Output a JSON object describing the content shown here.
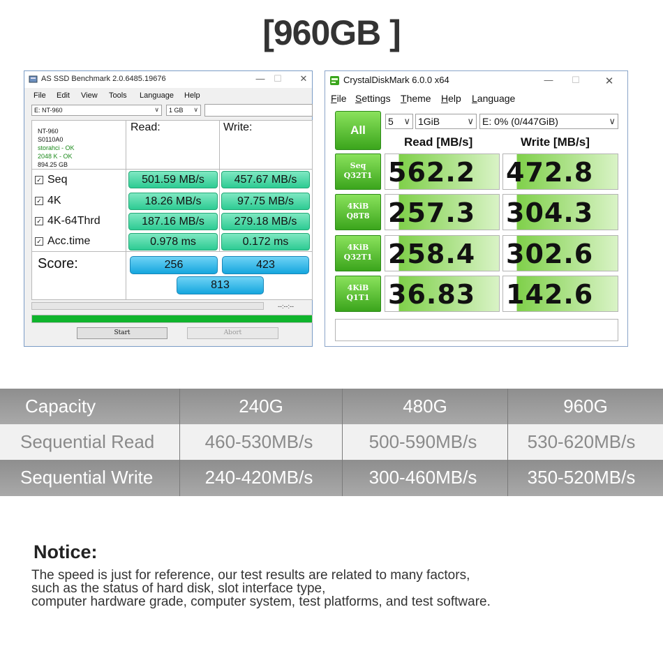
{
  "heading": "[960GB ]",
  "asssd": {
    "title": "AS SSD Benchmark 2.0.6485.19676",
    "menu": [
      "File",
      "Edit",
      "View",
      "Tools",
      "Language",
      "Help"
    ],
    "drive_select": "E: NT-960",
    "size_select": "1 GB",
    "drive_info": {
      "model": "NT-960",
      "firmware": "S0110A0",
      "driver": "storahci - OK",
      "alignment": "2048 K - OK",
      "capacity": "894.25 GB"
    },
    "read_header": "Read:",
    "write_header": "Write:",
    "rows": [
      {
        "label": "Seq",
        "read": "501.59 MB/s",
        "write": "457.67 MB/s"
      },
      {
        "label": "4K",
        "read": "18.26 MB/s",
        "write": "97.75 MB/s"
      },
      {
        "label": "4K-64Thrd",
        "read": "187.16 MB/s",
        "write": "279.18 MB/s"
      },
      {
        "label": "Acc.time",
        "read": "0.978 ms",
        "write": "0.172 ms"
      }
    ],
    "score_label": "Score:",
    "score_read": "256",
    "score_write": "423",
    "score_total": "813",
    "time_text": "--:--:--",
    "progress": 1.0,
    "start_label": "Start",
    "abort_label": "Abort"
  },
  "cdm": {
    "title": "CrystalDiskMark 6.0.0 x64",
    "menu": [
      {
        "first": "F",
        "rest": "ile"
      },
      {
        "first": "S",
        "rest": "ettings"
      },
      {
        "first": "T",
        "rest": "heme"
      },
      {
        "first": "H",
        "rest": "elp"
      },
      {
        "first": "L",
        "rest": "anguage"
      }
    ],
    "all_label": "All",
    "count_select": "5",
    "size_select": "1GiB",
    "drive_select": "E: 0% (0/447GiB)",
    "read_header": "Read [MB/s]",
    "write_header": "Write [MB/s]",
    "tests": [
      {
        "line1": "Seq",
        "line2": "Q32T1",
        "read": "562.2",
        "write": "472.8"
      },
      {
        "line1": "4KiB",
        "line2": "Q8T8",
        "read": "257.3",
        "write": "304.3"
      },
      {
        "line1": "4KiB",
        "line2": "Q32T1",
        "read": "258.4",
        "write": "302.6"
      },
      {
        "line1": "4KiB",
        "line2": "Q1T1",
        "read": "36.83",
        "write": "142.6"
      }
    ]
  },
  "spec_table": {
    "header": [
      "Capacity",
      "240G",
      "480G",
      "960G"
    ],
    "rows": [
      [
        "Sequential Read",
        "460-530MB/s",
        "500-590MB/s",
        "530-620MB/s"
      ],
      [
        "Sequential Write",
        "240-420MB/s",
        "300-460MB/s",
        "350-520MB/s"
      ]
    ]
  },
  "notice": {
    "title": "Notice:",
    "lines": [
      "The speed is just for reference, our test results are related to many factors,",
      "such as the status of hard disk, slot interface type,",
      "computer hardware grade, computer system, test platforms, and test software."
    ]
  }
}
